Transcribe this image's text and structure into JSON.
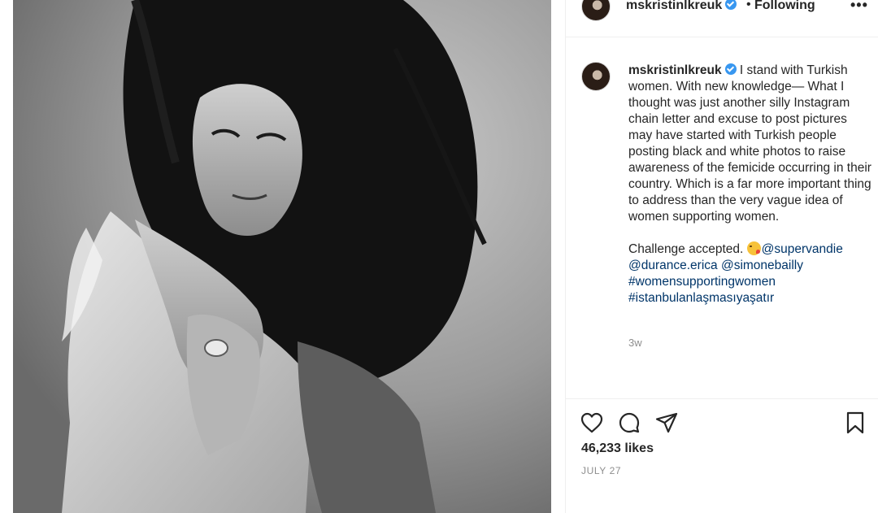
{
  "post": {
    "username": "mskristinlkreuk",
    "follow_dot": "•",
    "follow_label": "Following",
    "more_label": "•••",
    "caption_line1": "I stand with Turkish women. With new knowledge— What I thought was just another silly Instagram chain letter and excuse to post pictures may have started with Turkish people posting black and white photos to raise awareness of the femicide occurring in their country. Which is a far more important thing to address than the very vague idea of women supporting women.",
    "caption_line2_prefix": "Challenge accepted.",
    "mentions": [
      "@supervandie",
      "@durance.erica",
      "@simonebailly"
    ],
    "hashtags": [
      "#womensupportingwomen",
      "#istanbulanlaşmasıyaşatır"
    ],
    "caption_age": "3w",
    "likes": "46,233 likes",
    "date": "JULY 27"
  },
  "icons": {
    "verified": "verified-badge-icon",
    "like": "heart-icon",
    "comment": "comment-bubble-icon",
    "share": "paper-plane-icon",
    "save": "bookmark-icon",
    "emoji": "kissing-face-emoji-icon"
  },
  "colors": {
    "link": "#003569",
    "verified": "#3897f0",
    "muted": "#8e8e8e",
    "text": "#262626"
  }
}
